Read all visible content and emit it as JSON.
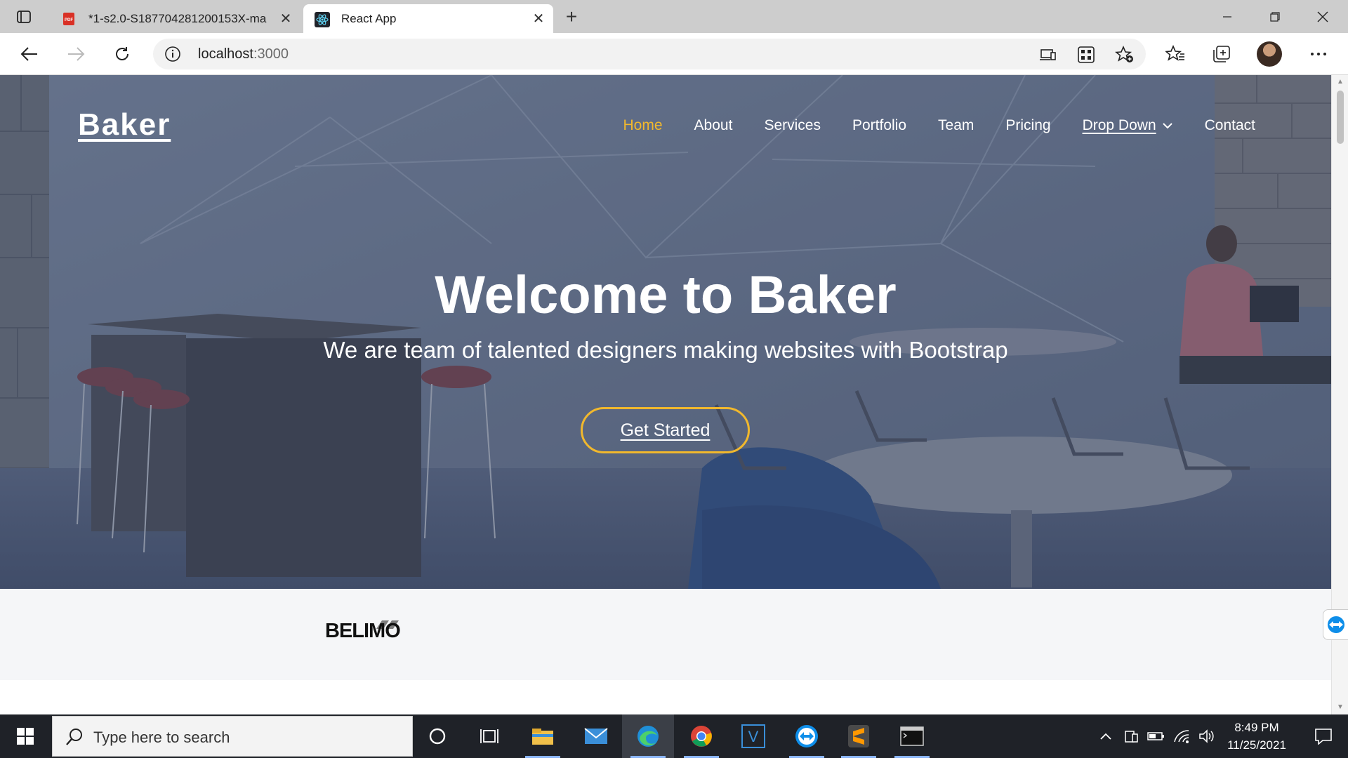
{
  "browser": {
    "tabs": [
      {
        "title": "*1-s2.0-S187704281200153X-ma",
        "favicon": "pdf-icon"
      },
      {
        "title": "React App",
        "favicon": "react-icon"
      }
    ],
    "address": {
      "host": "localhost",
      "port": ":3000"
    }
  },
  "site": {
    "brand": "Baker",
    "nav": [
      {
        "label": "Home",
        "active": true
      },
      {
        "label": "About"
      },
      {
        "label": "Services"
      },
      {
        "label": "Portfolio"
      },
      {
        "label": "Team"
      },
      {
        "label": "Pricing"
      },
      {
        "label": "Drop Down",
        "dropdown": true
      },
      {
        "label": "Contact"
      }
    ],
    "hero": {
      "title": "Welcome to Baker",
      "subtitle": "We are team of talented designers making websites with Bootstrap",
      "cta": "Get Started"
    },
    "clients": [
      "BELIMO"
    ],
    "colors": {
      "accent": "#f1b82d",
      "hero_overlay": "#4a5a78"
    }
  },
  "taskbar": {
    "search_placeholder": "Type here to search",
    "time": "8:49 PM",
    "date": "11/25/2021"
  }
}
